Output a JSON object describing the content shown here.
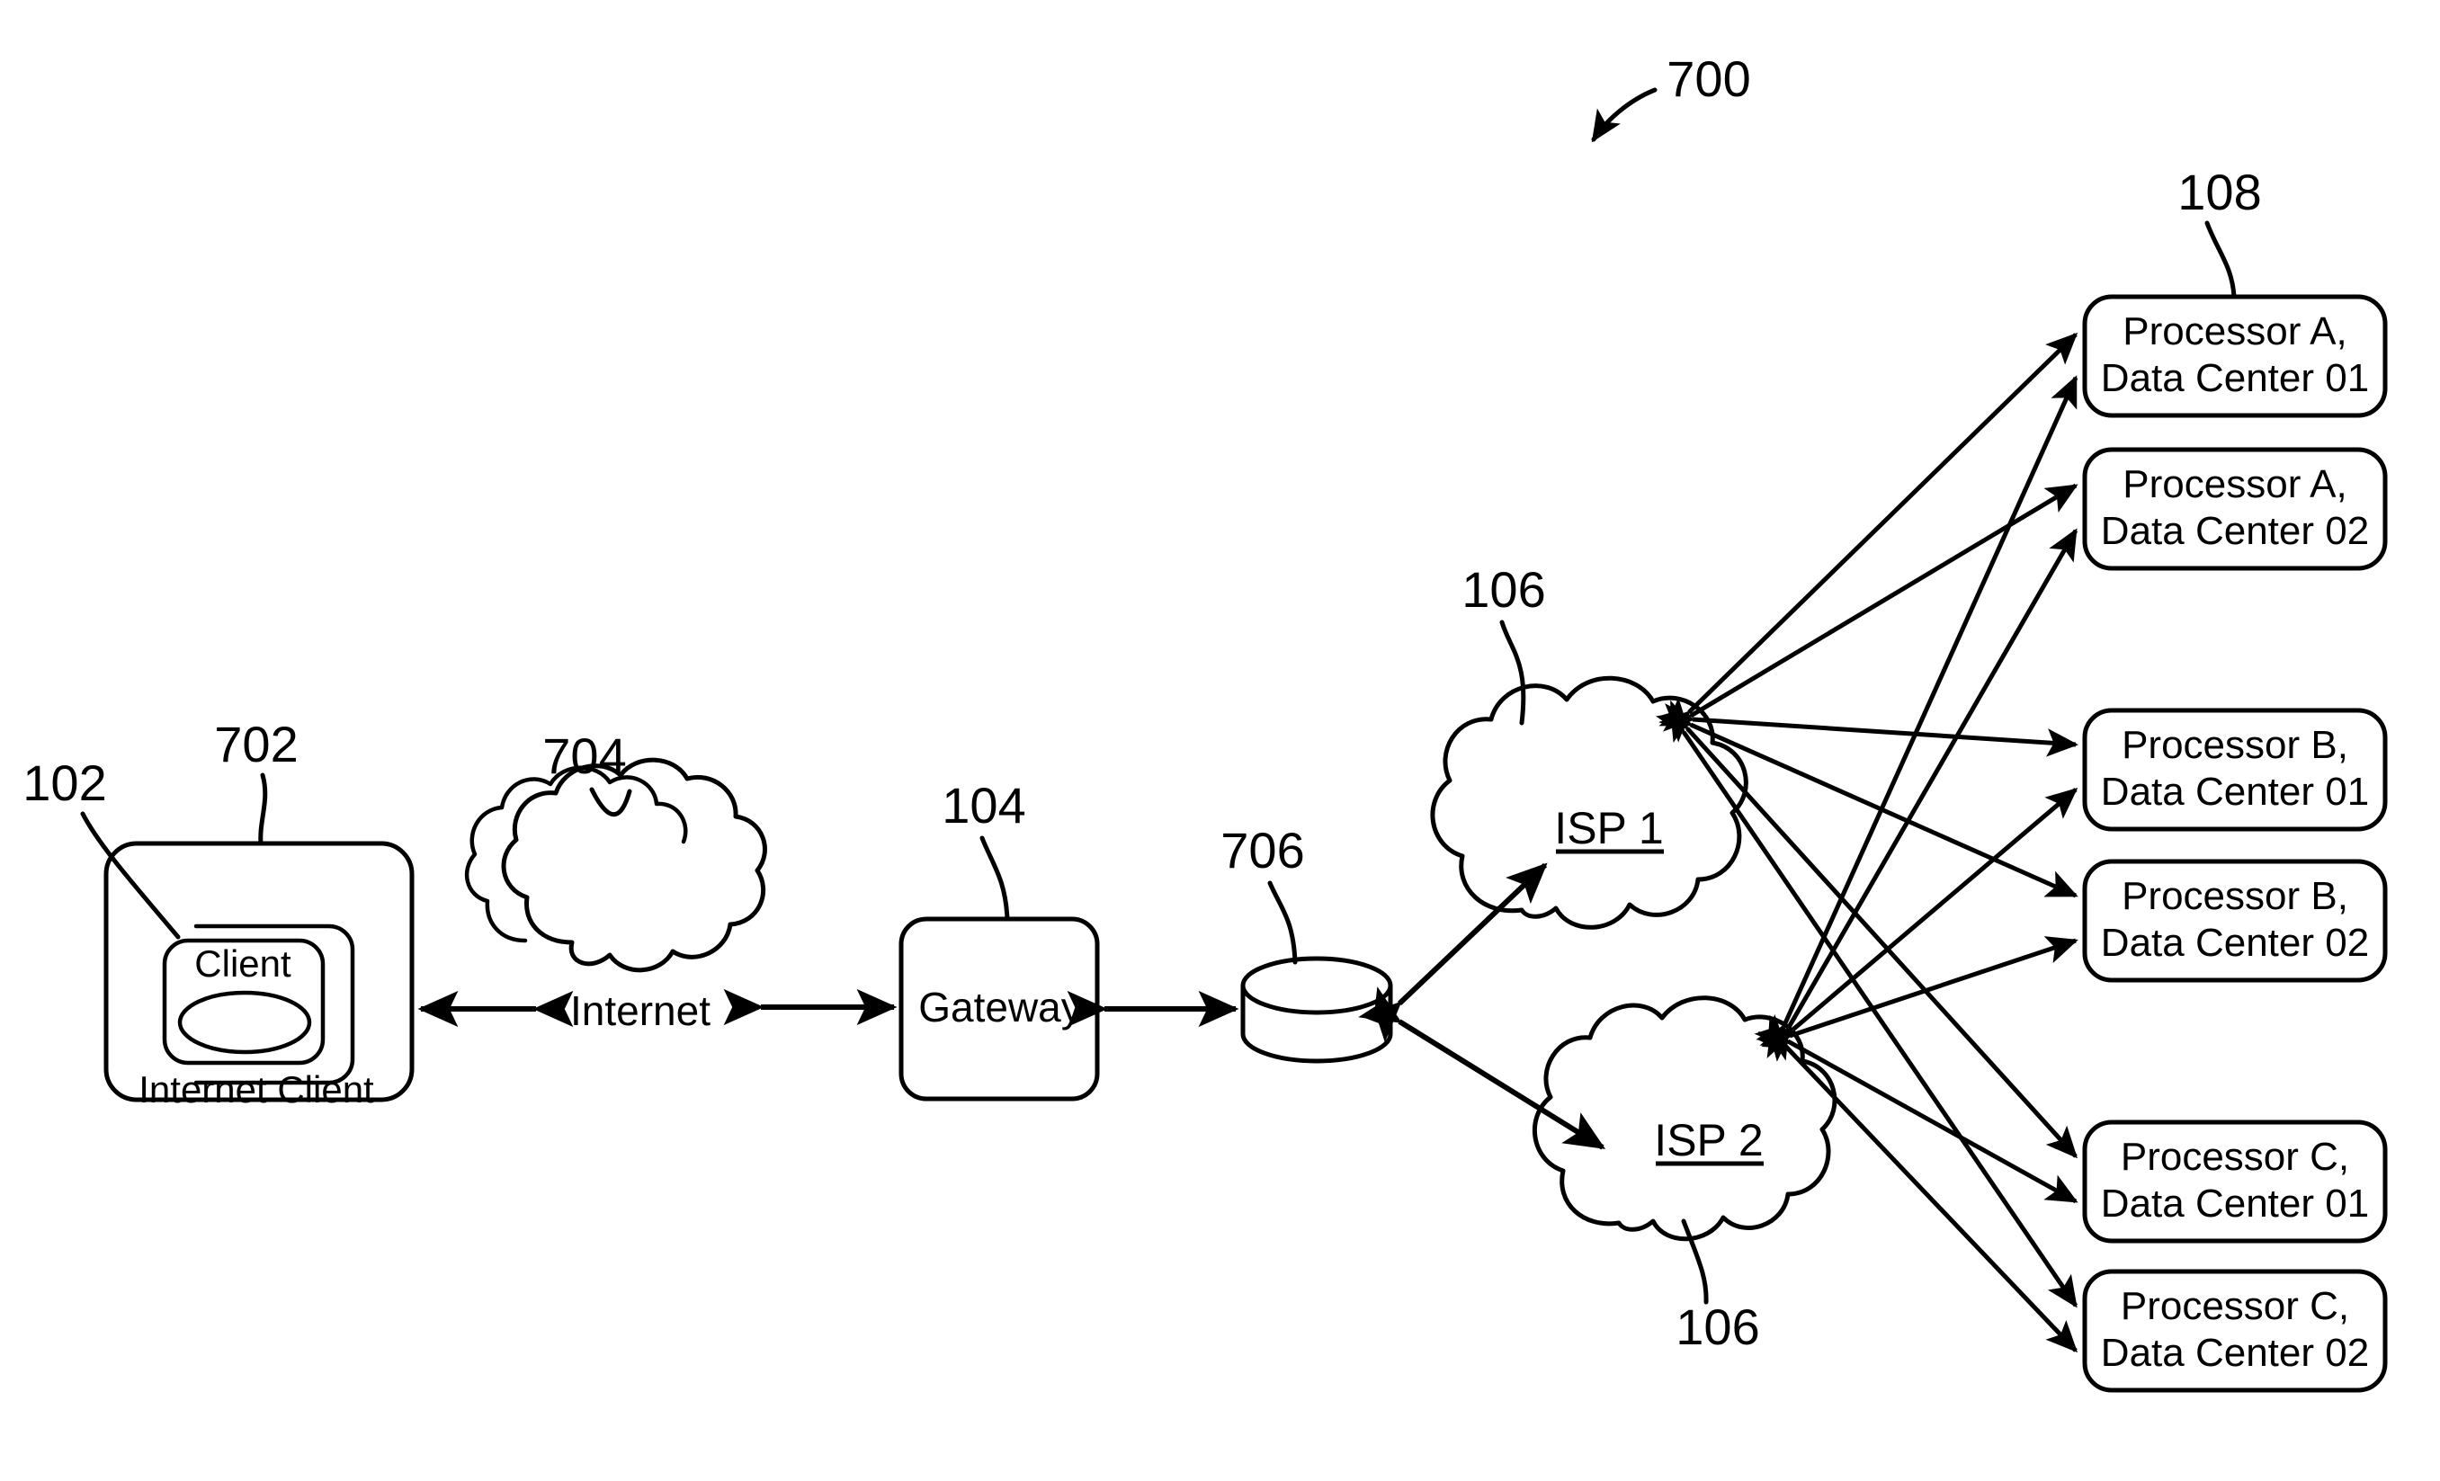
{
  "figure": {
    "number": "700",
    "background_color": "#ffffff",
    "line_color": "#000000"
  },
  "reference_numerals": {
    "internet_client": "102",
    "client_inner": "702",
    "internet_cloud": "704",
    "gateway": "104",
    "disk": "706",
    "isp_upper": "106",
    "isp_lower": "106",
    "processors_group": "108"
  },
  "nodes": {
    "internet_client": {
      "outer_label": "Internet Client",
      "inner_label": "Client"
    },
    "internet": {
      "label": "Internet"
    },
    "gateway": {
      "label": "Gateway"
    },
    "disk": {
      "label": ""
    },
    "isp1": {
      "label": "ISP 1"
    },
    "isp2": {
      "label": "ISP 2"
    }
  },
  "processors": [
    {
      "line1": "Processor A,",
      "line2": "Data Center 01"
    },
    {
      "line1": "Processor A,",
      "line2": "Data Center 02"
    },
    {
      "line1": "Processor B,",
      "line2": "Data Center 01"
    },
    {
      "line1": "Processor B,",
      "line2": "Data Center 02"
    },
    {
      "line1": "Processor C,",
      "line2": "Data Center 01"
    },
    {
      "line1": "Processor C,",
      "line2": "Data Center 02"
    }
  ]
}
